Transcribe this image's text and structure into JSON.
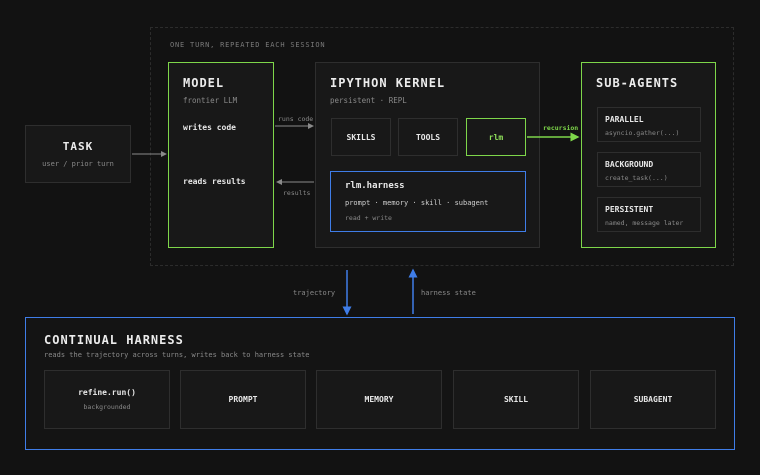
{
  "session": {
    "label": "ONE TURN, REPEATED EACH SESSION"
  },
  "task": {
    "title": "TASK",
    "subtitle": "user / prior turn"
  },
  "model": {
    "title": "MODEL",
    "subtitle": "frontier LLM",
    "writes": "writes code",
    "reads": "reads results"
  },
  "arrows": {
    "runs_code": "runs code",
    "results": "results",
    "recursion": "recursion",
    "trajectory": "trajectory",
    "harness_state": "harness state"
  },
  "kernel": {
    "title": "IPYTHON KERNEL",
    "subtitle": "persistent · REPL",
    "skills": "SKILLS",
    "tools": "TOOLS",
    "rlm": "rlm",
    "harness_title": "rlm.harness",
    "harness_items": "prompt · memory · skill · subagent",
    "harness_rw": "read + write"
  },
  "subagents": {
    "title": "SUB-AGENTS",
    "items": [
      {
        "label": "PARALLEL",
        "desc": "asyncio.gather(...)"
      },
      {
        "label": "BACKGROUND",
        "desc": "create_task(...)"
      },
      {
        "label": "PERSISTENT",
        "desc": "named, message later"
      }
    ]
  },
  "continual": {
    "title": "CONTINUAL HARNESS",
    "subtitle": "reads the trajectory across turns, writes back to harness state",
    "cards": [
      {
        "label": "refine.run()",
        "desc": "backgrounded"
      },
      {
        "label": "PROMPT",
        "desc": ""
      },
      {
        "label": "MEMORY",
        "desc": ""
      },
      {
        "label": "SKILL",
        "desc": ""
      },
      {
        "label": "SUBAGENT",
        "desc": ""
      }
    ]
  },
  "colors": {
    "green": "#7ed64a",
    "blue": "#3f7de8",
    "background": "#121212",
    "box": "#181818"
  }
}
